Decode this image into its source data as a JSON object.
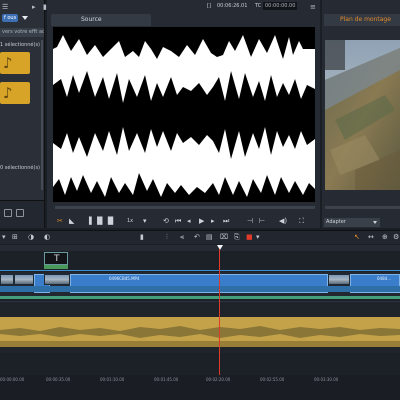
{
  "library": {
    "filter_label": "f ous",
    "search_text": "vers votre efft actu",
    "selection_top": "1 sélectionné(s)",
    "selection_bottom": "0 sélectionné(s)"
  },
  "source": {
    "tab_label": "Source",
    "duration": "00:06:26.01",
    "tc_label": "TC",
    "timecode_value": "00:00:00.00",
    "speed": "1x"
  },
  "monitor": {
    "tab_label": "Plan de montage",
    "zoom_select": "Adapter"
  },
  "timeline": {
    "clip_labels": [
      "0496CB45.MP4",
      "0484..."
    ],
    "ruler_ticks": [
      "00:00:00.00",
      "00:00:35.00",
      "00:01:10.00",
      "00:01:45.00",
      "00:02:20.00",
      "00:02:55.00",
      "00:03:30.00"
    ]
  },
  "colors": {
    "accent_orange": "#e08a2a",
    "playhead": "#e03a2a",
    "video_clip": "#3a7ecb",
    "audio_clip": "#c4a24a"
  }
}
